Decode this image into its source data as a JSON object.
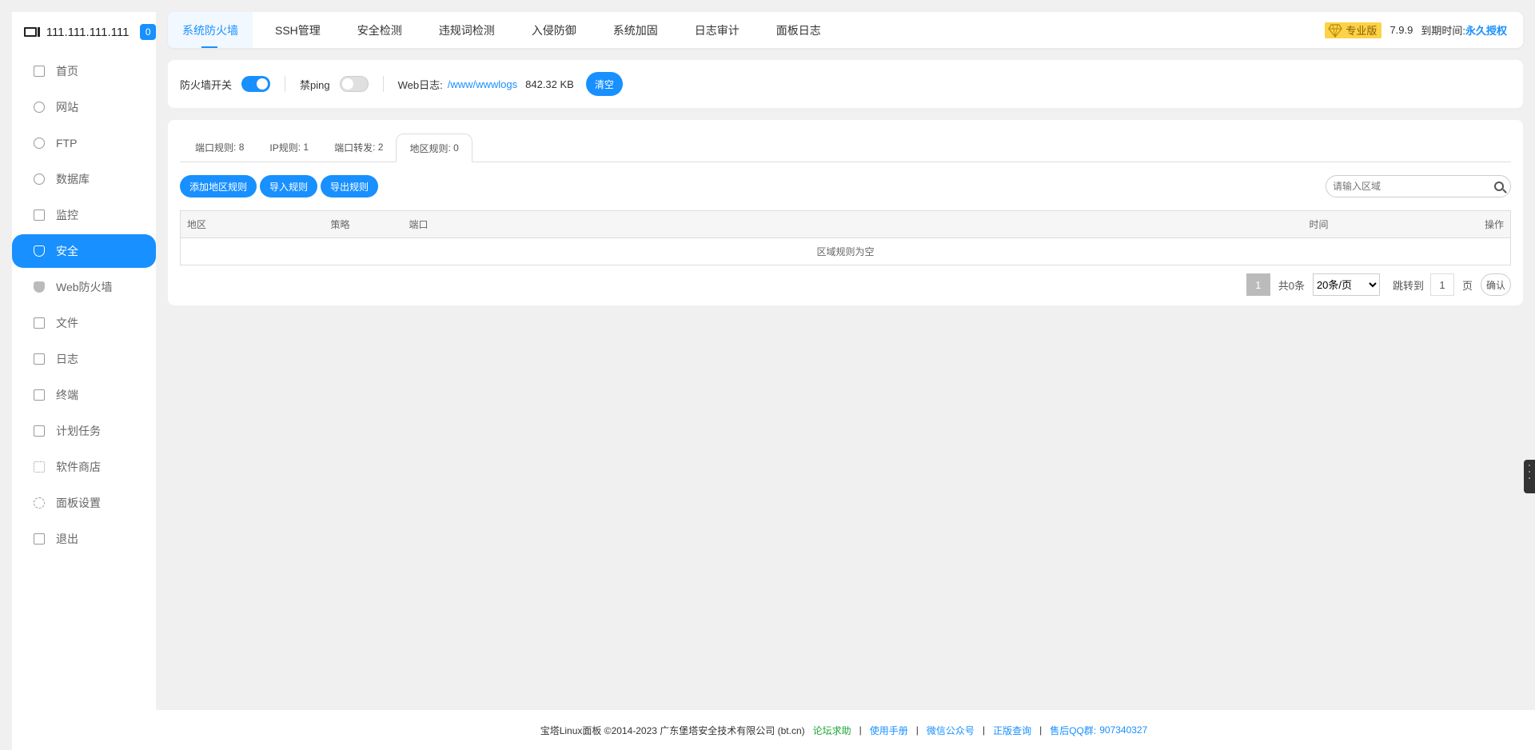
{
  "sidebar": {
    "ip": "111.111.111.111",
    "badge": "0",
    "items": [
      {
        "label": "首页",
        "icon": "home-icon"
      },
      {
        "label": "网站",
        "icon": "globe-icon"
      },
      {
        "label": "FTP",
        "icon": "ftp-icon"
      },
      {
        "label": "数据库",
        "icon": "database-icon"
      },
      {
        "label": "监控",
        "icon": "monitor-icon"
      },
      {
        "label": "安全",
        "icon": "shield-icon",
        "active": true
      },
      {
        "label": "Web防火墙",
        "icon": "waf-shield-icon"
      },
      {
        "label": "文件",
        "icon": "folder-icon"
      },
      {
        "label": "日志",
        "icon": "log-icon"
      },
      {
        "label": "终端",
        "icon": "terminal-icon"
      },
      {
        "label": "计划任务",
        "icon": "calendar-icon"
      },
      {
        "label": "软件商店",
        "icon": "apps-icon"
      },
      {
        "label": "面板设置",
        "icon": "gear-icon"
      },
      {
        "label": "退出",
        "icon": "logout-icon"
      }
    ]
  },
  "topnav": {
    "tabs": [
      "系统防火墙",
      "SSH管理",
      "安全检测",
      "违规词检测",
      "入侵防御",
      "系统加固",
      "日志审计",
      "面板日志"
    ],
    "edition": "专业版",
    "version": "7.9.9",
    "expire_label": "到期时间:",
    "expire_value": "永久授权"
  },
  "settings": {
    "firewall_label": "防火墙开关",
    "firewall_on": true,
    "ping_label": "禁ping",
    "ping_on": false,
    "weblog_label": "Web日志:",
    "weblog_path": "/www/wwwlogs",
    "weblog_size": "842.32 KB",
    "clear_label": "清空"
  },
  "subtabs": [
    {
      "label": "端口规则",
      "count": "8"
    },
    {
      "label": "IP规则",
      "count": "1"
    },
    {
      "label": "端口转发",
      "count": "2"
    },
    {
      "label": "地区规则",
      "count": "0",
      "active": true
    }
  ],
  "toolbar": {
    "add_label": "添加地区规则",
    "import_label": "导入规则",
    "export_label": "导出规则",
    "search_placeholder": "请输入区域"
  },
  "table": {
    "columns": [
      "地区",
      "策略",
      "端口",
      "时间",
      "操作"
    ],
    "empty_text": "区域规则为空"
  },
  "pager": {
    "current": "1",
    "total": "共0条",
    "per_page": "20条/页",
    "jump_label": "跳转到",
    "jump_value": "1",
    "unit": "页",
    "confirm": "确认"
  },
  "footer": {
    "copyright": "宝塔Linux面板 ©2014-2023 广东堡塔安全技术有限公司 (bt.cn)",
    "links": [
      "论坛求助",
      "使用手册",
      "微信公众号",
      "正版查询"
    ],
    "qq_label": "售后QQ群:",
    "qq_value": "907340327"
  },
  "colors": {
    "accent": "#1890ff",
    "green": "#20a53a",
    "pro_gold": "#fcd347"
  }
}
